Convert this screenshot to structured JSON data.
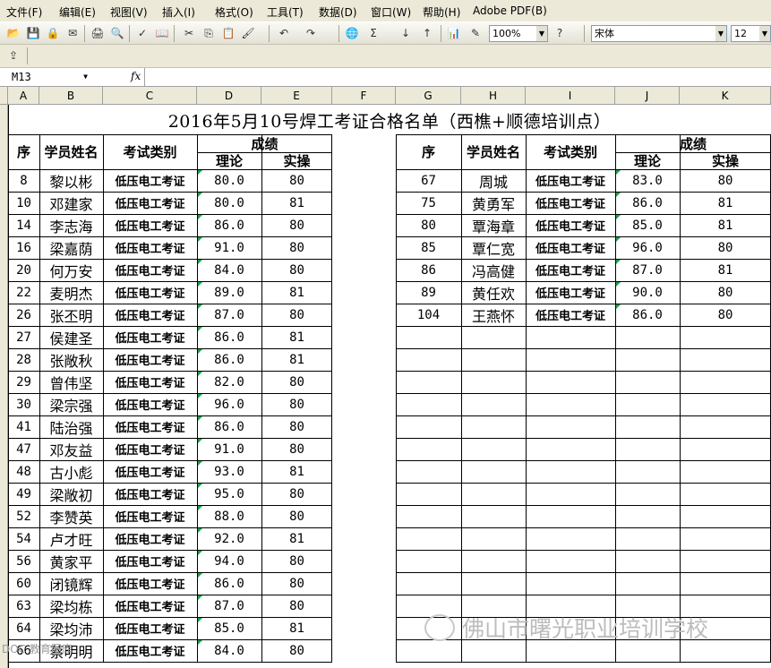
{
  "menu": [
    "文件(F)",
    "编辑(E)",
    "视图(V)",
    "插入(I)",
    "格式(O)",
    "工具(T)",
    "数据(D)",
    "窗口(W)",
    "帮助(H)",
    "Adobe PDF(B)"
  ],
  "toolbar": {
    "zoom": "100%",
    "font": "宋体",
    "size": "12"
  },
  "namebox": "M13",
  "fx_label": "fx",
  "columns": [
    "A",
    "B",
    "C",
    "D",
    "E",
    "F",
    "G",
    "H",
    "I",
    "J",
    "K"
  ],
  "sheet": {
    "title": "2016年5月10号焊工考证合格名单（西樵+顺德培训点）",
    "headers": {
      "seq": "序",
      "name": "学员姓名",
      "type": "考试类别",
      "score": "成绩",
      "theory": "理论",
      "practice": "实操"
    },
    "left_rows": [
      {
        "seq": "8",
        "name": "黎以彬",
        "type": "低压电工考证",
        "theory": "80.0",
        "practice": "80"
      },
      {
        "seq": "10",
        "name": "邓建家",
        "type": "低压电工考证",
        "theory": "80.0",
        "practice": "81"
      },
      {
        "seq": "14",
        "name": "李志海",
        "type": "低压电工考证",
        "theory": "86.0",
        "practice": "80"
      },
      {
        "seq": "16",
        "name": "梁嘉荫",
        "type": "低压电工考证",
        "theory": "91.0",
        "practice": "80"
      },
      {
        "seq": "20",
        "name": "何万安",
        "type": "低压电工考证",
        "theory": "84.0",
        "practice": "80"
      },
      {
        "seq": "22",
        "name": "麦明杰",
        "type": "低压电工考证",
        "theory": "89.0",
        "practice": "81"
      },
      {
        "seq": "26",
        "name": "张丕明",
        "type": "低压电工考证",
        "theory": "87.0",
        "practice": "80"
      },
      {
        "seq": "27",
        "name": "侯建圣",
        "type": "低压电工考证",
        "theory": "86.0",
        "practice": "81"
      },
      {
        "seq": "28",
        "name": "张敞秋",
        "type": "低压电工考证",
        "theory": "86.0",
        "practice": "81"
      },
      {
        "seq": "29",
        "name": "曾伟坚",
        "type": "低压电工考证",
        "theory": "82.0",
        "practice": "80"
      },
      {
        "seq": "30",
        "name": "梁宗强",
        "type": "低压电工考证",
        "theory": "96.0",
        "practice": "80"
      },
      {
        "seq": "41",
        "name": "陆治强",
        "type": "低压电工考证",
        "theory": "86.0",
        "practice": "80"
      },
      {
        "seq": "47",
        "name": "邓友益",
        "type": "低压电工考证",
        "theory": "91.0",
        "practice": "80"
      },
      {
        "seq": "48",
        "name": "古小彪",
        "type": "低压电工考证",
        "theory": "93.0",
        "practice": "81"
      },
      {
        "seq": "49",
        "name": "梁敞初",
        "type": "低压电工考证",
        "theory": "95.0",
        "practice": "80"
      },
      {
        "seq": "52",
        "name": "李赞英",
        "type": "低压电工考证",
        "theory": "88.0",
        "practice": "80"
      },
      {
        "seq": "54",
        "name": "卢才旺",
        "type": "低压电工考证",
        "theory": "92.0",
        "practice": "81"
      },
      {
        "seq": "56",
        "name": "黄家平",
        "type": "低压电工考证",
        "theory": "94.0",
        "practice": "80"
      },
      {
        "seq": "60",
        "name": "闭镜辉",
        "type": "低压电工考证",
        "theory": "86.0",
        "practice": "80"
      },
      {
        "seq": "63",
        "name": "梁均栋",
        "type": "低压电工考证",
        "theory": "87.0",
        "practice": "80"
      },
      {
        "seq": "64",
        "name": "梁均沛",
        "type": "低压电工考证",
        "theory": "85.0",
        "practice": "81"
      },
      {
        "seq": "66",
        "name": "蔡明明",
        "type": "低压电工考证",
        "theory": "84.0",
        "practice": "80"
      }
    ],
    "right_rows": [
      {
        "seq": "67",
        "name": "周城",
        "type": "低压电工考证",
        "theory": "83.0",
        "practice": "80"
      },
      {
        "seq": "75",
        "name": "黄勇军",
        "type": "低压电工考证",
        "theory": "86.0",
        "practice": "81"
      },
      {
        "seq": "80",
        "name": "覃海章",
        "type": "低压电工考证",
        "theory": "85.0",
        "practice": "81"
      },
      {
        "seq": "85",
        "name": "覃仁宽",
        "type": "低压电工考证",
        "theory": "96.0",
        "practice": "80"
      },
      {
        "seq": "86",
        "name": "冯高健",
        "type": "低压电工考证",
        "theory": "87.0",
        "practice": "81"
      },
      {
        "seq": "89",
        "name": "黄任欢",
        "type": "低压电工考证",
        "theory": "90.0",
        "practice": "80"
      },
      {
        "seq": "104",
        "name": "王燕怀",
        "type": "低压电工考证",
        "theory": "86.0",
        "practice": "80"
      }
    ]
  },
  "watermark": "佛山市曙光职业培训学校",
  "watermark_small": "DOC 教育图库"
}
